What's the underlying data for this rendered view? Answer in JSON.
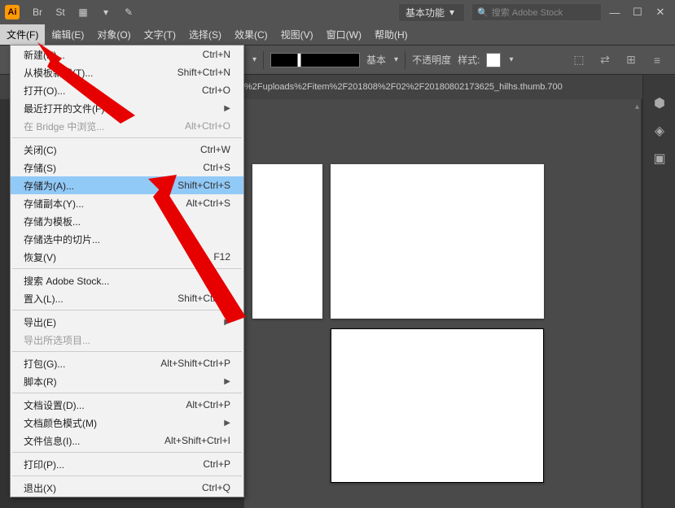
{
  "app": {
    "icon_text": "Ai"
  },
  "titlebar": {
    "workspace_label": "基本功能",
    "search_placeholder": "搜索 Adobe Stock"
  },
  "menubar": {
    "items": [
      {
        "label": "文件(F)"
      },
      {
        "label": "编辑(E)"
      },
      {
        "label": "对象(O)"
      },
      {
        "label": "文字(T)"
      },
      {
        "label": "选择(S)"
      },
      {
        "label": "效果(C)"
      },
      {
        "label": "视图(V)"
      },
      {
        "label": "窗口(W)"
      },
      {
        "label": "帮助(H)"
      }
    ]
  },
  "optbar": {
    "stroke_label": "基本",
    "opacity_label": "不透明度",
    "style_label": "样式:"
  },
  "tabbar": {
    "doc_title": "%2Fuploads%2Fitem%2F201808%2F02%2F20180802173625_hilhs.thumb.700"
  },
  "file_menu": {
    "groups": [
      [
        {
          "label": "新建(N)...",
          "shortcut": "Ctrl+N"
        },
        {
          "label": "从模板新建(T)...",
          "shortcut": "Shift+Ctrl+N"
        },
        {
          "label": "打开(O)...",
          "shortcut": "Ctrl+O"
        },
        {
          "label": "最近打开的文件(F)",
          "submenu": true
        },
        {
          "label": "在 Bridge 中浏览...",
          "shortcut": "Alt+Ctrl+O",
          "disabled": true
        }
      ],
      [
        {
          "label": "关闭(C)",
          "shortcut": "Ctrl+W"
        },
        {
          "label": "存储(S)",
          "shortcut": "Ctrl+S"
        },
        {
          "label": "存储为(A)...",
          "shortcut": "Shift+Ctrl+S",
          "highlighted": true
        },
        {
          "label": "存储副本(Y)...",
          "shortcut": "Alt+Ctrl+S"
        },
        {
          "label": "存储为模板..."
        },
        {
          "label": "存储选中的切片..."
        },
        {
          "label": "恢复(V)",
          "shortcut": "F12"
        }
      ],
      [
        {
          "label": "搜索 Adobe Stock..."
        },
        {
          "label": "置入(L)...",
          "shortcut": "Shift+Ctrl+P"
        }
      ],
      [
        {
          "label": "导出(E)",
          "submenu": true
        },
        {
          "label": "导出所选项目...",
          "disabled": true
        }
      ],
      [
        {
          "label": "打包(G)...",
          "shortcut": "Alt+Shift+Ctrl+P"
        },
        {
          "label": "脚本(R)",
          "submenu": true
        }
      ],
      [
        {
          "label": "文档设置(D)...",
          "shortcut": "Alt+Ctrl+P"
        },
        {
          "label": "文档颜色模式(M)",
          "submenu": true
        },
        {
          "label": "文件信息(I)...",
          "shortcut": "Alt+Shift+Ctrl+I"
        }
      ],
      [
        {
          "label": "打印(P)...",
          "shortcut": "Ctrl+P"
        }
      ],
      [
        {
          "label": "退出(X)",
          "shortcut": "Ctrl+Q"
        }
      ]
    ]
  }
}
